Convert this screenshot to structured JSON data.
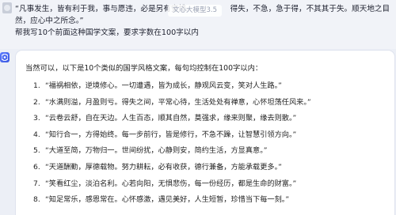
{
  "user": {
    "line1": "“凡事发生，皆有利于我，事与愿违，必是另有安排。",
    "line1_tail": "得失，不急，急于得，不其其于失。顺天地之目",
    "line2": "然，应心中之所念。”",
    "line3": "帮我写10个前面这种国学文案，要求字数在100字以内"
  },
  "tooltip": "文心大模型3.5",
  "assistant": {
    "intro": "当然可以，以下是10个类似的国学风格文案，每句均控制在100字以内：",
    "items": [
      {
        "num": "1.",
        "text": "“福祸相依，逆境修心。一切遭遇，皆为成长，静观风云变，笑对人生路。”"
      },
      {
        "num": "2.",
        "text": "“水满则溢，月盈则亏。得失之间，平常心待，生活处处有禅意，心怀坦荡任风来。”"
      },
      {
        "num": "3.",
        "text": "“云卷云舒，自在天边。人生百态，顺其自然，莫强求，缘来则聚，缘去则散。”"
      },
      {
        "num": "4.",
        "text": "“知行合一，方得始终。每一步前行，皆是修行，不急不躁，让智慧引领方向。”"
      },
      {
        "num": "5.",
        "text": "“大道至简，万物归一。世间纷扰，心静则安，简约生活，方显真意。”"
      },
      {
        "num": "6.",
        "text": "“天道酬勤，厚德载物。努力耕耘，必有收获，德行兼备，方能承载更多。”"
      },
      {
        "num": "7.",
        "text": "“笑看红尘，淡泊名利。心若向阳，无惧悲伤，每一份经历，都是生命的财富。”"
      },
      {
        "num": "8.",
        "text": "“知足常乐，感恩常在。心怀感激，遇见美好，人生短暂，珍惜当下每一刻。”"
      }
    ]
  },
  "colors": {
    "background": "#eceff6",
    "card": "#ffffff",
    "accent": "#4a67ee"
  },
  "icons": {
    "user_avatar": "user-avatar-icon",
    "bot_avatar": "bot-avatar-icon"
  }
}
